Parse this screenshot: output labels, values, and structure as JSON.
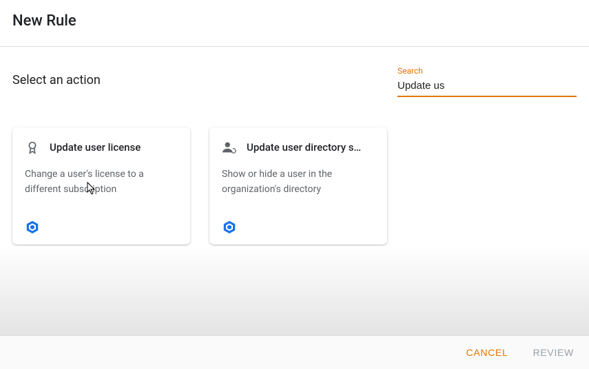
{
  "header": {
    "title": "New Rule"
  },
  "section": {
    "title": "Select an action"
  },
  "search": {
    "label": "Search",
    "value": "Update us"
  },
  "cards": [
    {
      "icon": "badge-icon",
      "title": "Update user license",
      "description": "Change a user's license to a different subscription"
    },
    {
      "icon": "person-sync-icon",
      "title": "Update user directory s…",
      "description": "Show or hide a user in the organization's directory"
    }
  ],
  "footer": {
    "cancel": "CANCEL",
    "review": "REVIEW"
  }
}
